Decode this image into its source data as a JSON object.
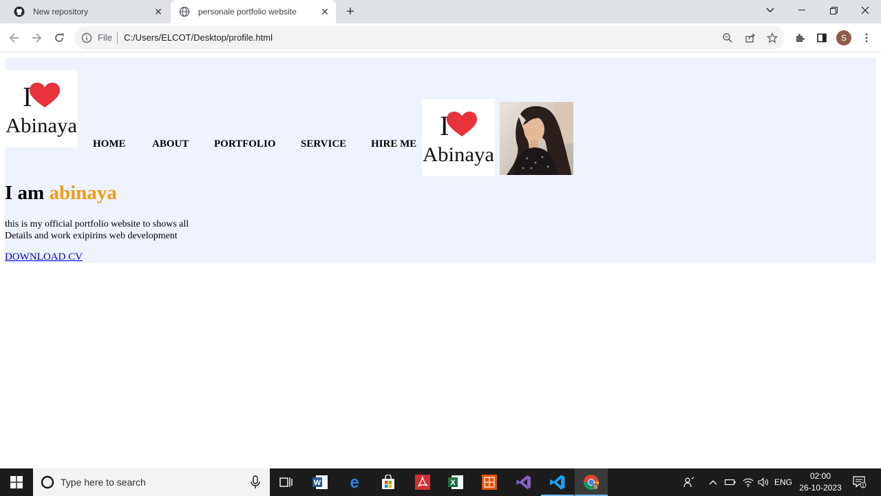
{
  "browser": {
    "tabs": [
      {
        "title": "New repository",
        "active": false
      },
      {
        "title": "personale portfolio website",
        "active": true
      }
    ],
    "address": {
      "scheme_label": "File",
      "url": "C:/Users/ELCOT/Desktop/profile.html"
    },
    "profile_initial": "S"
  },
  "page": {
    "logo_text": {
      "line1": "I",
      "line2": "Abinaya"
    },
    "nav": [
      "HOME",
      "ABOUT",
      "PORTFOLIO",
      "SERVICE",
      "HIRE ME"
    ],
    "headline": {
      "prefix": "I am ",
      "name": "abinaya"
    },
    "description": [
      "this is my official portfolio website to shows all",
      "Details and work exipirins web development"
    ],
    "cv_link": "DOWNLOAD CV",
    "colors": {
      "hero_bg": "#eef3fd",
      "accent": "#f39c12",
      "link": "#0000ee",
      "heart": "#e8323c"
    }
  },
  "taskbar": {
    "search_placeholder": "Type here to search",
    "language": "ENG",
    "time": "02:00",
    "date": "26-10-2023",
    "notification_count": "1",
    "pinned_apps": [
      "task-view-icon",
      "word-icon",
      "edge-icon",
      "store-icon",
      "acrobat-icon",
      "excel-icon",
      "vlc-icon",
      "visual-studio-icon",
      "vscode-icon",
      "chrome-icon"
    ]
  }
}
